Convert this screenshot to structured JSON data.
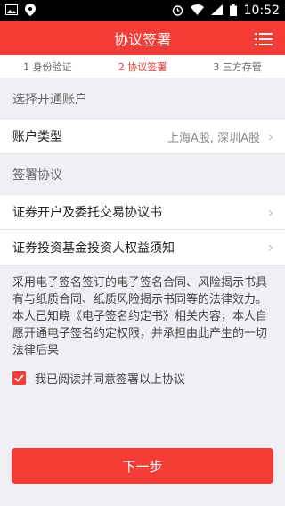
{
  "status_bar": {
    "time": "10:52",
    "icons": [
      "image-icon",
      "location-icon",
      "alarm-icon",
      "wifi-icon",
      "signal-icon",
      "battery-icon"
    ]
  },
  "nav": {
    "title": "协议签署",
    "menu_icon": "list-menu-icon"
  },
  "steps": [
    {
      "label": "1 身份验证",
      "active": false
    },
    {
      "label": "2 协议签署",
      "active": true
    },
    {
      "label": "3 三方存管",
      "active": false
    }
  ],
  "section_account": {
    "label": "选择开通账户",
    "account_type_label": "账户类型",
    "account_type_value": "上海A股, 深圳A股"
  },
  "section_protocol": {
    "label": "签署协议",
    "items": [
      {
        "label": "证券开户及委托交易协议书"
      },
      {
        "label": "证券投资基金投资人权益须知"
      }
    ]
  },
  "notice_text": "采用电子签名签订的电子签名合同、风险揭示书具有与纸质合同、纸质风险揭示书同等的法律效力。本人已知晓《电子签名约定书》相关内容，本人自愿开通电子签名约定权限，并承担由此产生的一切法律后果",
  "agree": {
    "checked": true,
    "label": "我已阅读并同意签署以上协议"
  },
  "next_button": "下一步",
  "colors": {
    "accent": "#f23c35",
    "background": "#efeff4"
  }
}
